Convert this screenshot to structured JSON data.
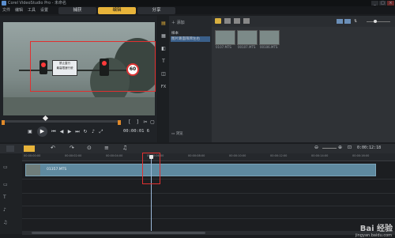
{
  "app": {
    "title": "Corel VideoStudio Pro - 未命名"
  },
  "menu": [
    "文件",
    "编辑",
    "工具",
    "设置"
  ],
  "steps": [
    "捕获",
    "编辑",
    "分享"
  ],
  "active_step": "编辑",
  "library": {
    "add_label": "添加",
    "folders": [
      "样本",
      "图片路面限牌左右"
    ],
    "browse_label": "浏览",
    "thumbs": [
      "0107.MTS",
      "00107.MTS",
      "00106.MTS"
    ]
  },
  "player": {
    "timecode": "00:00:01 6",
    "sign_text": [
      "禁止直行",
      "最高限速行驶"
    ],
    "speed_sign": "60"
  },
  "timeline": {
    "ruler_labels": [
      "00:00:00:00",
      "00:00:02:00",
      "00:00:04:00",
      "00:00:06:00",
      "00:00:08:00",
      "00:00:10:00",
      "00:00:12:00",
      "00:00:14:00",
      "00:00:16:00"
    ],
    "clip_label": "01357.MTS",
    "time_display": "0:00:12:18"
  },
  "watermark": {
    "brand": "Bai 经验",
    "url": "jingyan.baidu.com"
  },
  "colors": {
    "accent": "#e8b43a",
    "clip": "#5f8aa0",
    "highlight": "#e03030"
  }
}
